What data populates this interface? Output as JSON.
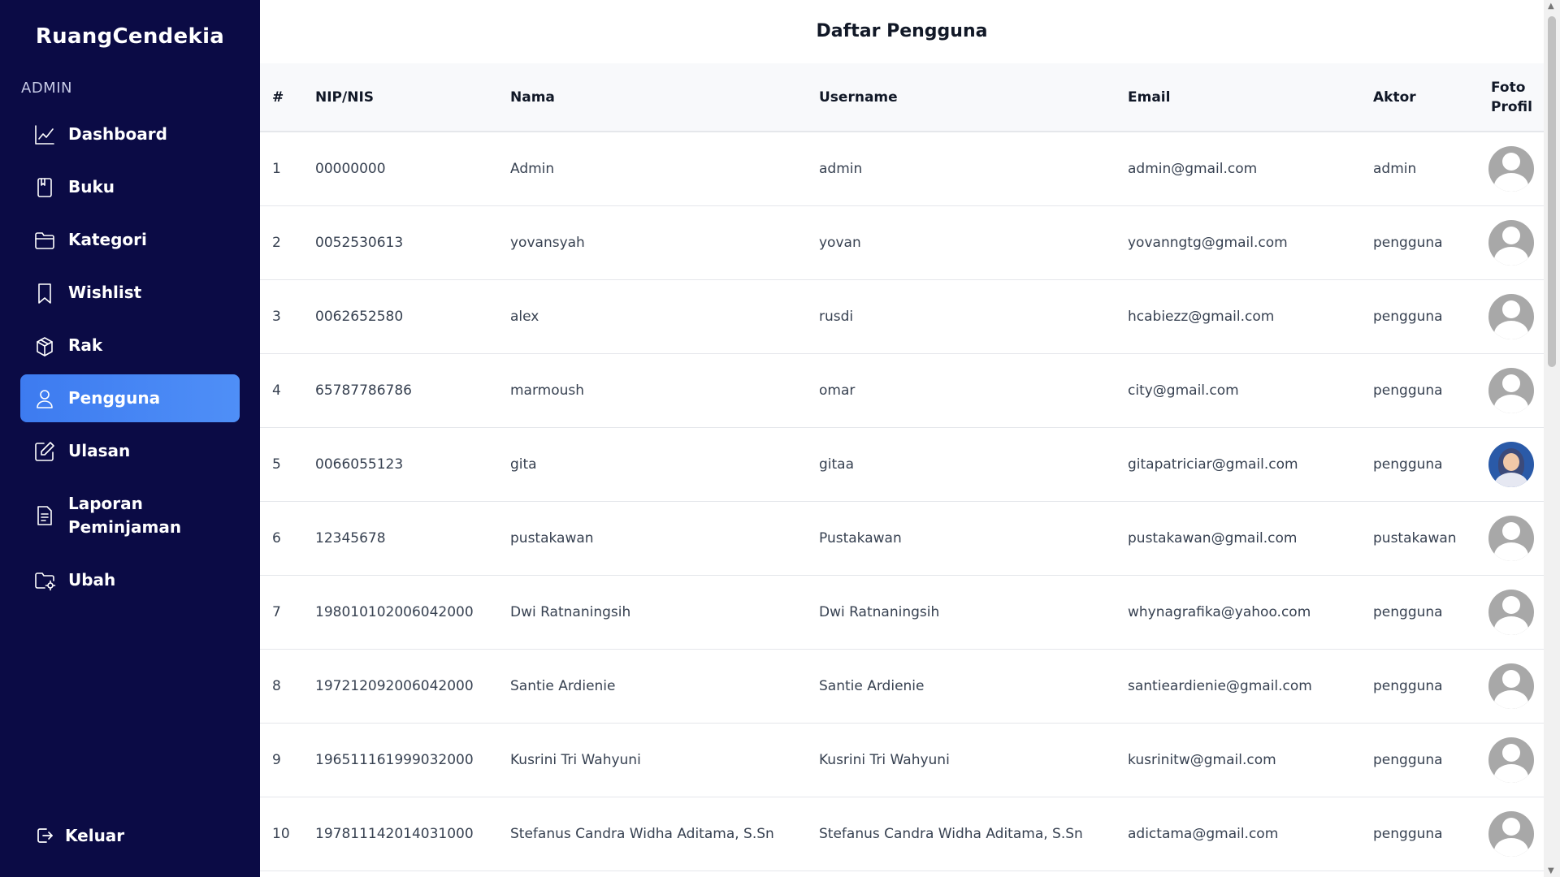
{
  "sidebar": {
    "brand": "RuangCendekia",
    "section_label": "ADMIN",
    "items": [
      {
        "label": "Dashboard",
        "icon": "chart-line-icon"
      },
      {
        "label": "Buku",
        "icon": "book-icon"
      },
      {
        "label": "Kategori",
        "icon": "folder-icon"
      },
      {
        "label": "Wishlist",
        "icon": "bookmark-icon"
      },
      {
        "label": "Rak",
        "icon": "box-icon"
      },
      {
        "label": "Pengguna",
        "icon": "user-icon",
        "active": true
      },
      {
        "label": "Ulasan",
        "icon": "edit-icon"
      },
      {
        "label": "Laporan Peminjaman",
        "icon": "document-icon"
      },
      {
        "label": "Ubah",
        "icon": "folder-settings-icon"
      }
    ],
    "logout_label": "Keluar",
    "accent_color": "#3d7bf0",
    "background_color": "#0b0b45"
  },
  "main": {
    "title": "Daftar Pengguna",
    "table": {
      "headers": [
        "#",
        "NIP/NIS",
        "Nama",
        "Username",
        "Email",
        "Aktor",
        "Foto Profil"
      ],
      "rows": [
        {
          "no": "1",
          "nip": "00000000",
          "nama": "Admin",
          "username": "admin",
          "email": "admin@gmail.com",
          "aktor": "admin",
          "foto": "default-avatar-icon"
        },
        {
          "no": "2",
          "nip": "0052530613",
          "nama": "yovansyah",
          "username": "yovan",
          "email": "yovanngtg@gmail.com",
          "aktor": "pengguna",
          "foto": "default-avatar-icon"
        },
        {
          "no": "3",
          "nip": "0062652580",
          "nama": "alex",
          "username": "rusdi",
          "email": "hcabiezz@gmail.com",
          "aktor": "pengguna",
          "foto": "default-avatar-icon"
        },
        {
          "no": "4",
          "nip": "65787786786",
          "nama": "marmoush",
          "username": "omar",
          "email": "city@gmail.com",
          "aktor": "pengguna",
          "foto": "default-avatar-icon"
        },
        {
          "no": "5",
          "nip": "0066055123",
          "nama": "gita",
          "username": "gitaa",
          "email": "gitapatriciar@gmail.com",
          "aktor": "pengguna",
          "foto": "user-photo"
        },
        {
          "no": "6",
          "nip": "12345678",
          "nama": "pustakawan",
          "username": "Pustakawan",
          "email": "pustakawan@gmail.com",
          "aktor": "pustakawan",
          "foto": "default-avatar-icon"
        },
        {
          "no": "7",
          "nip": "198010102006042000",
          "nama": "Dwi Ratnaningsih",
          "username": "Dwi Ratnaningsih",
          "email": "whynagrafika@yahoo.com",
          "aktor": "pengguna",
          "foto": "default-avatar-icon"
        },
        {
          "no": "8",
          "nip": "197212092006042000",
          "nama": "Santie Ardienie",
          "username": "Santie Ardienie",
          "email": "santieardienie@gmail.com",
          "aktor": "pengguna",
          "foto": "default-avatar-icon"
        },
        {
          "no": "9",
          "nip": "196511161999032000",
          "nama": "Kusrini Tri Wahyuni",
          "username": "Kusrini Tri Wahyuni",
          "email": "kusrinitw@gmail.com",
          "aktor": "pengguna",
          "foto": "default-avatar-icon"
        },
        {
          "no": "10",
          "nip": "197811142014031000",
          "nama": "Stefanus Candra Widha Aditama, S.Sn",
          "username": "Stefanus Candra Widha Aditama, S.Sn",
          "email": "adictama@gmail.com",
          "aktor": "pengguna",
          "foto": "default-avatar-icon"
        }
      ]
    }
  }
}
